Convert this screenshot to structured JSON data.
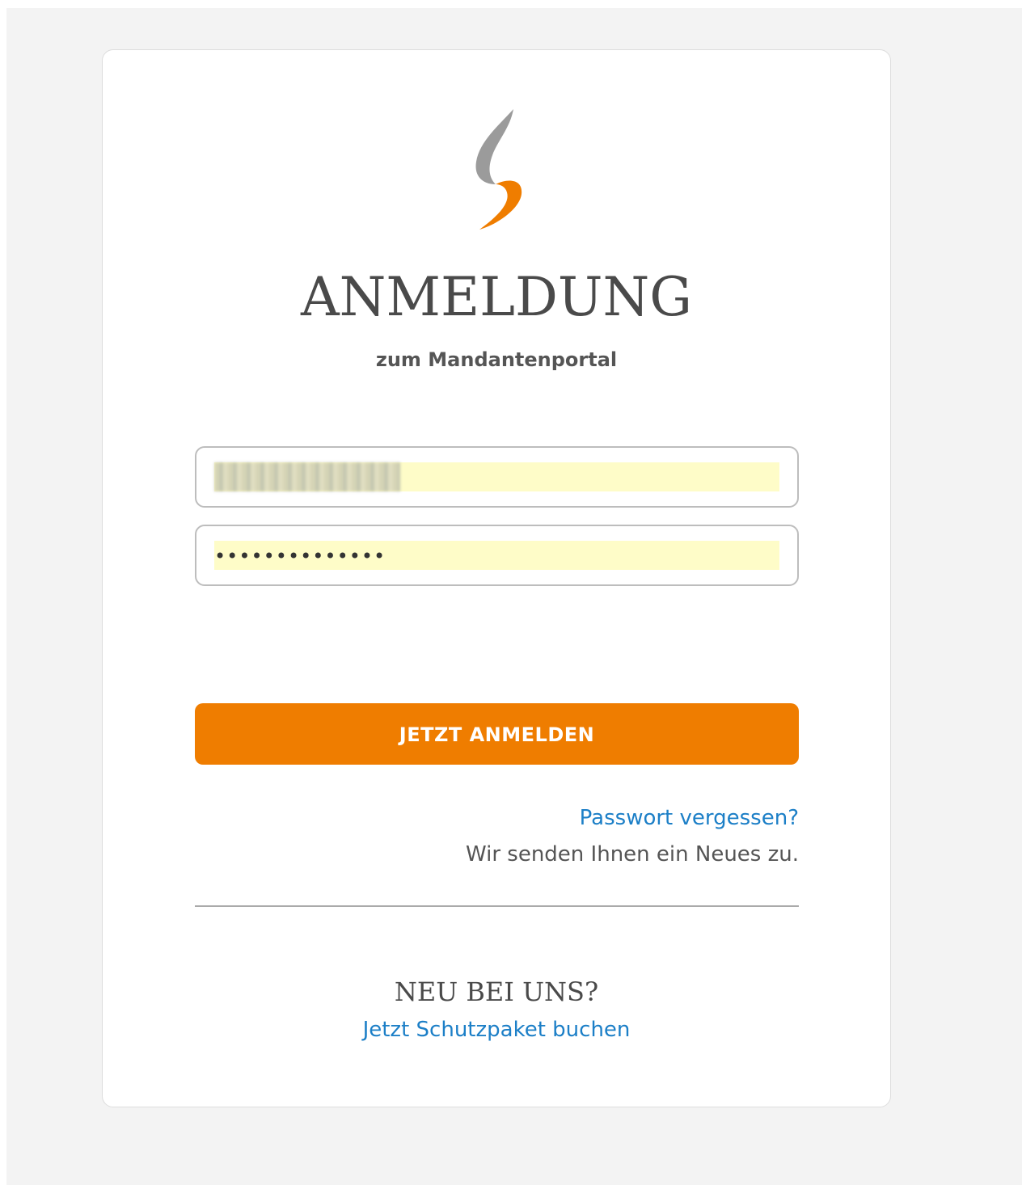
{
  "login": {
    "title": "ANMELDUNG",
    "subtitle": "zum Mandantenportal",
    "password_mask": "••••••••••••••",
    "submit_label": "JETZT ANMELDEN",
    "forgot_link": "Passwort vergessen?",
    "forgot_note": "Wir senden Ihnen ein Neues zu."
  },
  "register": {
    "heading": "NEU BEI UNS?",
    "link": "Jetzt Schutzpaket buchen"
  },
  "colors": {
    "accent": "#ef7d00",
    "link": "#1c7fc7",
    "logo_gray": "#9b9b9b",
    "autofill": "#fefcc8"
  },
  "icons": {
    "logo": "brand-logo-icon"
  }
}
